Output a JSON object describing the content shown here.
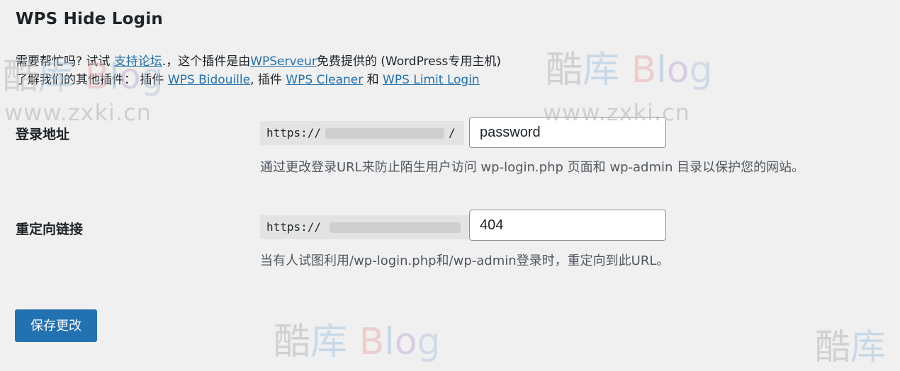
{
  "page": {
    "title": "WPS Hide Login"
  },
  "help": {
    "line1_text1": "需要帮忙吗? 试试 ",
    "support_link": "支持论坛",
    "line1_text2": ".，这个插件是由",
    "author_link": "WPServeur",
    "line1_text3": "免费提供的 (WordPress专用主机)",
    "line2_text1": "了解我们的其他插件： 插件 ",
    "plugin1_link": "WPS Bidouille",
    "line2_text2": ", 插件 ",
    "plugin2_link": "WPS Cleaner",
    "line2_text3": " 和 ",
    "plugin3_link": "WPS Limit Login"
  },
  "settings": {
    "login_url": {
      "label": "登录地址",
      "prefix_start": "https://",
      "prefix_end": "/",
      "value": "password",
      "description": "通过更改登录URL来防止陌生用户访问 wp-login.php 页面和 wp-admin 目录以保护您的网站。"
    },
    "redirect_url": {
      "label": "重定向链接",
      "prefix_start": "https://",
      "value": "404",
      "description": "当有人试图利用/wp-login.php和/wp-admin登录时，重定向到此URL。"
    }
  },
  "actions": {
    "save_label": "保存更改"
  },
  "watermark": {
    "ku": "酷",
    "ku2": "库",
    "b": "B",
    "l": "l",
    "o": "o",
    "g": "g",
    "url": "www.zxki.cn"
  },
  "colors": {
    "accent": "#2271b1",
    "background": "#f0f0f1",
    "text": "#1d2327",
    "description": "#50575e"
  }
}
